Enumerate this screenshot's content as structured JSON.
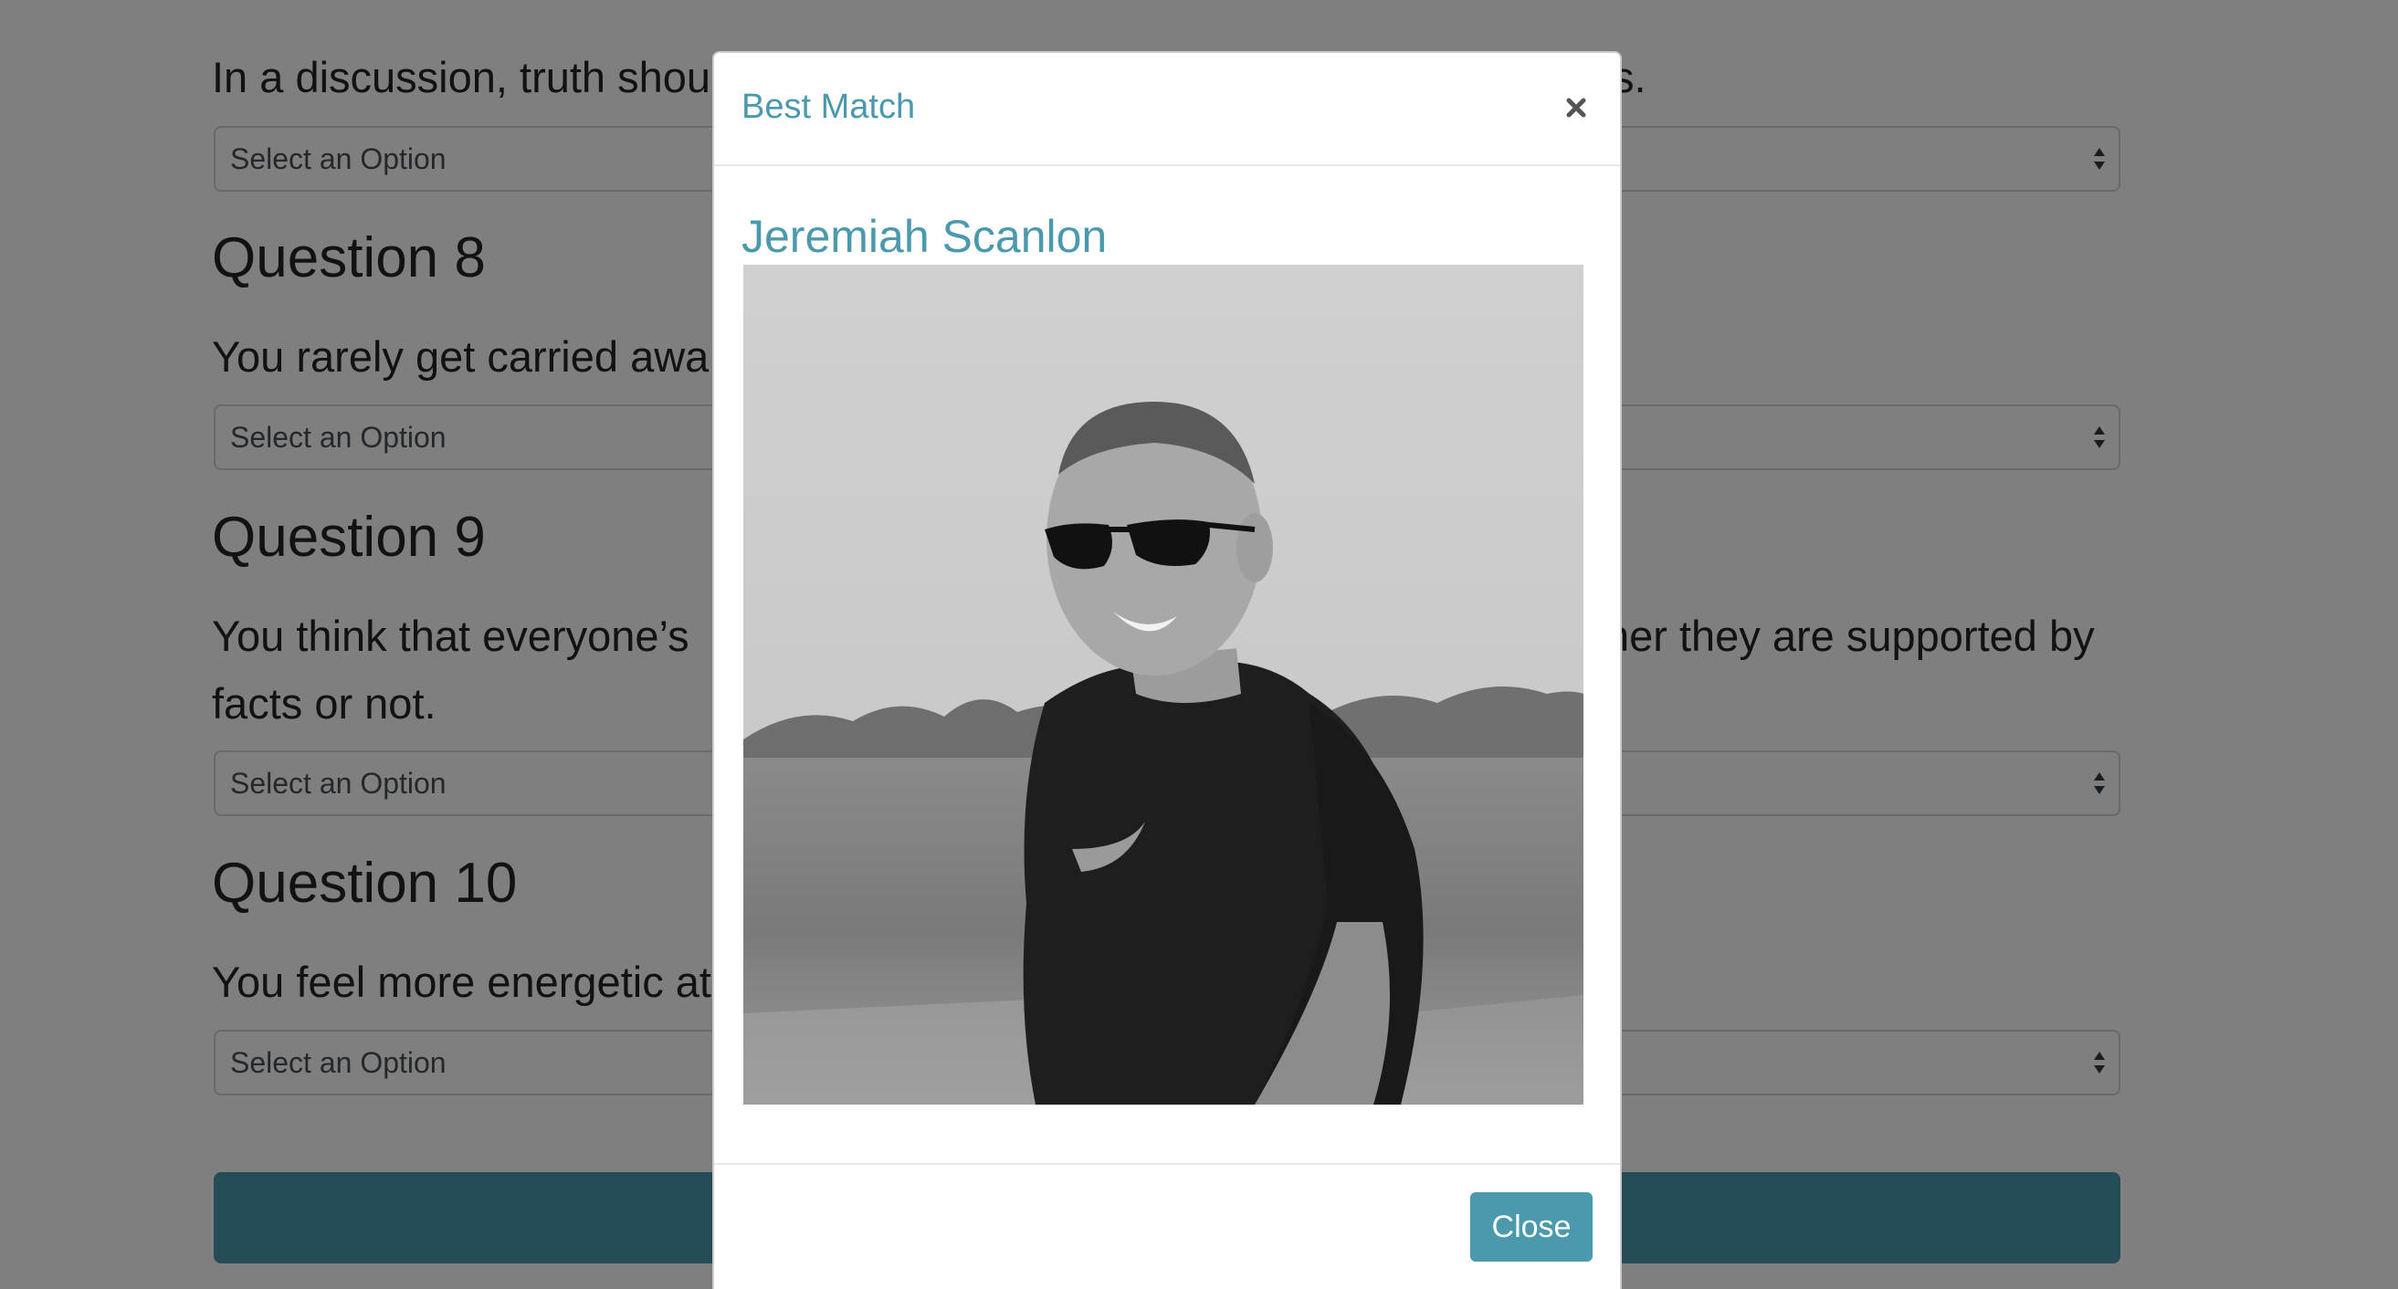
{
  "background_form": {
    "q7_prompt_partial": "In a discussion, truth shou",
    "q7_prompt_tail": "s.",
    "q7_select": "Select an Option",
    "q8_heading": "Question 8",
    "q8_prompt_partial": "You rarely get carried awa",
    "q8_select": "Select an Option",
    "q9_heading": "Question 9",
    "q9_prompt_partial": "You think that everyone’s",
    "q9_prompt_tail": "her they are supported by",
    "q9_prompt_line2": "facts or not.",
    "q9_select": "Select an Option",
    "q10_heading": "Question 10",
    "q10_prompt_partial": "You feel more energetic at",
    "q10_select": "Select an Option"
  },
  "modal": {
    "title": "Best Match",
    "match_name": "Jeremiah Scanlon",
    "close_label": "Close",
    "close_icon": "close-icon"
  },
  "colors": {
    "accent": "#4b99ad",
    "backdrop": "rgba(0,0,0,0.5)"
  }
}
